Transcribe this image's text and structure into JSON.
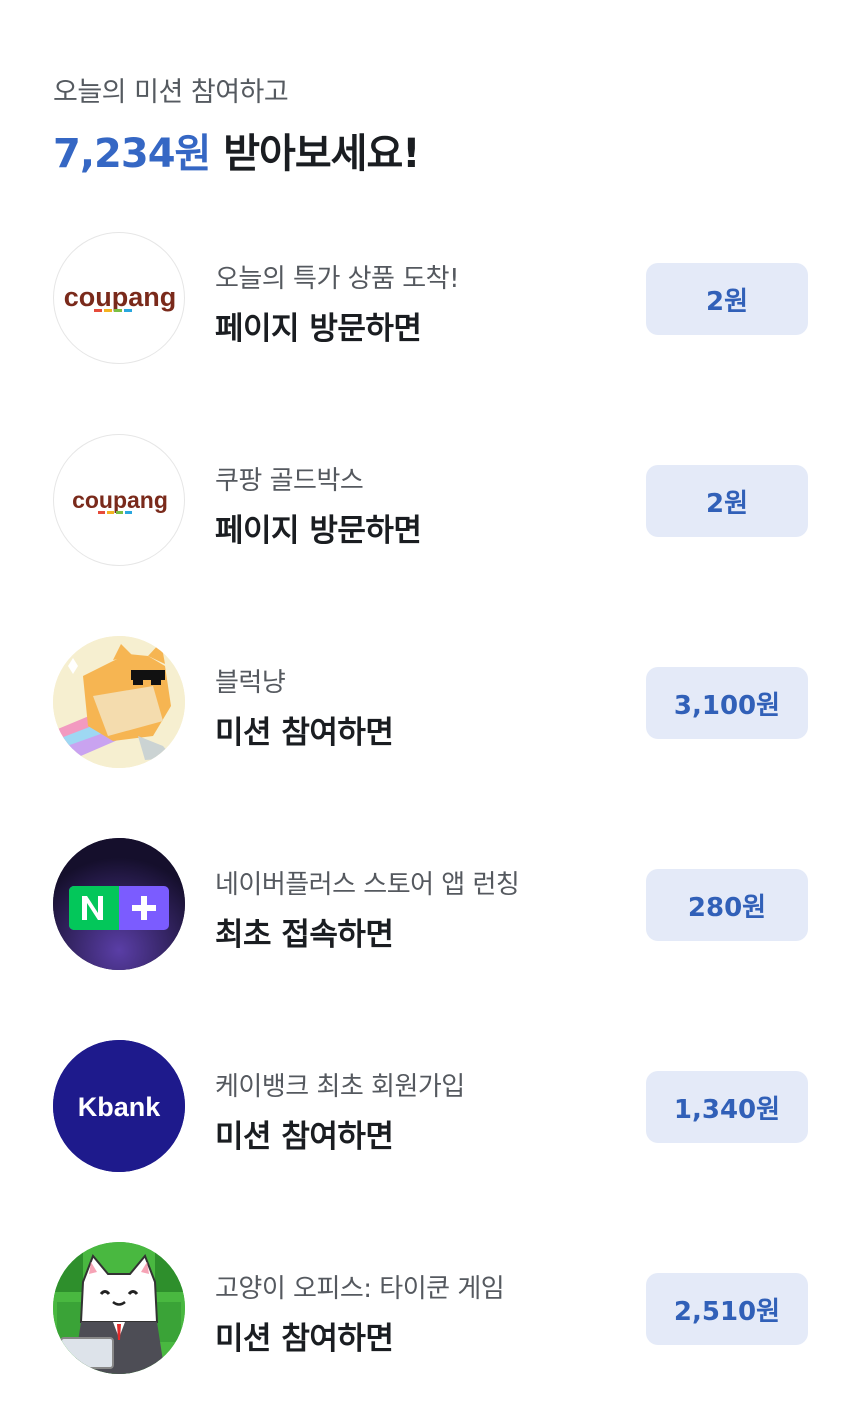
{
  "header": {
    "subtitle": "오늘의 미션 참여하고",
    "amount": "7,234원",
    "title_suffix": " 받아보세요!"
  },
  "missions": [
    {
      "logo": "coupang-logo",
      "logo_text": "coupang",
      "title": "오늘의 특가 상품 도착!",
      "action": "페이지 방문하면",
      "reward": "2원"
    },
    {
      "logo": "coupang-logo",
      "logo_text": "coupang",
      "title": "쿠팡 골드박스",
      "action": "페이지 방문하면",
      "reward": "2원"
    },
    {
      "logo": "block-cat-game-logo",
      "title": "블럭냥",
      "action": "미션 참여하면",
      "reward": "3,100원"
    },
    {
      "logo": "naver-plus-store-logo",
      "title": "네이버플러스 스토어 앱 런칭",
      "action": "최초 접속하면",
      "reward": "280원"
    },
    {
      "logo": "kbank-logo",
      "logo_text": "Kbank",
      "title": "케이뱅크 최초 회원가입",
      "action": "미션 참여하면",
      "reward": "1,340원"
    },
    {
      "logo": "cat-office-game-logo",
      "title": "고양이 오피스: 타이쿤 게임",
      "action": "미션 참여하면",
      "reward": "2,510원"
    }
  ],
  "colors": {
    "accent": "#3567c4",
    "reward_bg": "#e4eaf8",
    "reward_text": "#3160b8",
    "kbank_bg": "#1e1a8c",
    "naver_green": "#03c75a"
  }
}
